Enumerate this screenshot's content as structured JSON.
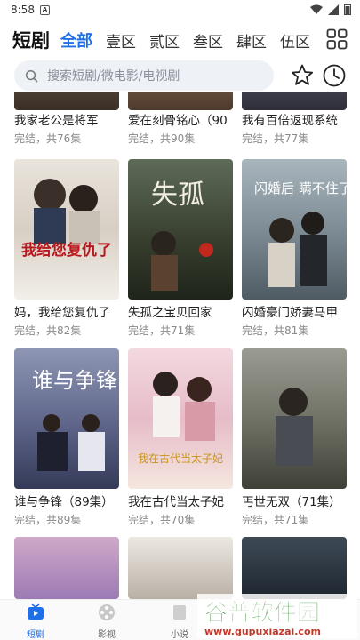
{
  "status": {
    "time": "8:58",
    "notif": "A"
  },
  "header": {
    "title": "短剧",
    "tabs": [
      {
        "label": "全部",
        "active": true
      },
      {
        "label": "壹区"
      },
      {
        "label": "贰区"
      },
      {
        "label": "叁区"
      },
      {
        "label": "肆区"
      },
      {
        "label": "伍区"
      }
    ]
  },
  "search": {
    "placeholder": "搜索短剧/微电影/电视剧"
  },
  "grid": {
    "items": [
      {
        "title": "我家老公是将军",
        "subtitle": "完结，共76集"
      },
      {
        "title": "爱在刻骨铭心（90",
        "subtitle": "完结，共90集"
      },
      {
        "title": "我有百倍返现系统",
        "subtitle": "完结，共77集"
      },
      {
        "title": "妈，我给您复仇了",
        "subtitle": "完结，共82集",
        "poster_text": "我给您复仇了"
      },
      {
        "title": "失孤之宝贝回家",
        "subtitle": "完结，共71集",
        "poster_text": "失孤"
      },
      {
        "title": "闪婚豪门娇妻马甲",
        "subtitle": "完结，共81集",
        "poster_text": "闪婚后 瞒不住了"
      },
      {
        "title": "谁与争锋（89集）",
        "subtitle": "完结，共89集",
        "poster_text": "谁与争锋"
      },
      {
        "title": "我在古代当太子妃",
        "subtitle": "完结，共70集",
        "poster_text": "我在古代当太子妃"
      },
      {
        "title": "丐世无双（71集）",
        "subtitle": "完结，共71集"
      }
    ]
  },
  "bottom_nav": [
    {
      "label": "短剧",
      "active": true
    },
    {
      "label": "影视"
    },
    {
      "label": "小说"
    }
  ],
  "watermark": {
    "brand": "谷普软件园",
    "url": "www.gupuxiazai.com"
  },
  "colors": {
    "accent": "#1e6fe8",
    "search_bg": "#eef1f6"
  }
}
